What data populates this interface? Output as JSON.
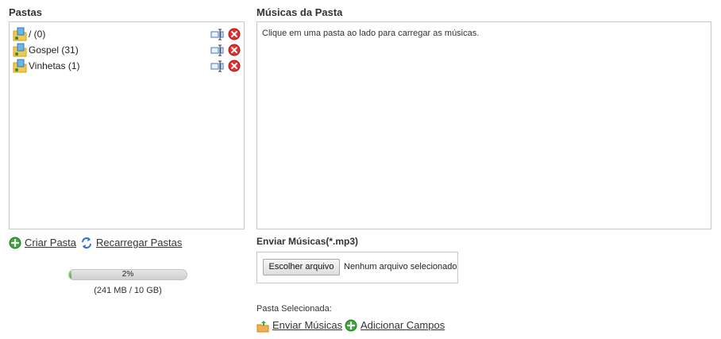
{
  "folders_panel": {
    "title": "Pastas",
    "items": [
      {
        "label": "/ (0)"
      },
      {
        "label": "Gospel (31)"
      },
      {
        "label": "Vinhetas (1)"
      }
    ]
  },
  "music_panel": {
    "title": "Músicas da Pasta",
    "message": "Clique em uma pasta ao lado para carregar as músicas."
  },
  "folder_actions": {
    "create": "Criar Pasta",
    "reload": "Recarregar Pastas"
  },
  "storage": {
    "percent": 2,
    "percent_label": "2%",
    "usage_label": "(241 MB / 10 GB)"
  },
  "upload": {
    "title": "Enviar Músicas(*.mp3)",
    "choose_button": "Escolher arquivo",
    "no_file": "Nenhum arquivo selecionado"
  },
  "selected": {
    "label": "Pasta Selecionada:",
    "send": "Enviar Músicas",
    "add_fields": "Adicionar Campos"
  },
  "colors": {
    "delete": "#e03030",
    "add": "#3aa83a",
    "reload": "#2f6fd6",
    "progress": "#3fb52a"
  },
  "icons": {
    "folder": "folder-music-icon",
    "edit": "rename-icon",
    "delete": "delete-icon",
    "create": "plus-circle-icon",
    "reload": "refresh-icon",
    "send": "upload-folder-icon",
    "add_fields": "plus-circle-icon"
  }
}
